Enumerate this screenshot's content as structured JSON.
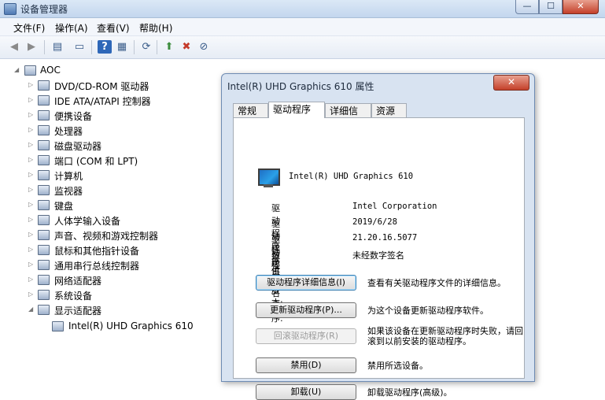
{
  "window": {
    "title": "设备管理器",
    "min": "—",
    "max": "☐",
    "close": "✕"
  },
  "menu": [
    "文件(F)",
    "操作(A)",
    "查看(V)",
    "帮助(H)"
  ],
  "tree": {
    "root": "AOC",
    "categories": [
      "DVD/CD-ROM 驱动器",
      "IDE ATA/ATAPI 控制器",
      "便携设备",
      "处理器",
      "磁盘驱动器",
      "端口 (COM 和 LPT)",
      "计算机",
      "监视器",
      "键盘",
      "人体学输入设备",
      "声音、视频和游戏控制器",
      "鼠标和其他指针设备",
      "通用串行总线控制器",
      "网络适配器",
      "系统设备",
      "显示适配器"
    ],
    "child": "Intel(R) UHD Graphics 610"
  },
  "dialog": {
    "title": "Intel(R) UHD Graphics 610 属性",
    "close": "✕",
    "tabs": [
      "常规",
      "驱动程序",
      "详细信息",
      "资源"
    ],
    "active_tab": "驱动程序",
    "device_name": "Intel(R) UHD Graphics 610",
    "info": [
      {
        "key": "驱动程序提供商:",
        "value": "Intel Corporation"
      },
      {
        "key": "驱动程序日期:",
        "value": "2019/6/28"
      },
      {
        "key": "驱动程序版本:",
        "value": "21.20.16.5077"
      },
      {
        "key": "数字签名程序:",
        "value": "未经数字签名"
      }
    ],
    "buttons": [
      {
        "label": "驱动程序详细信息(I)",
        "desc": "查看有关驱动程序文件的详细信息。",
        "state": "focused"
      },
      {
        "label": "更新驱动程序(P)...",
        "desc": "为这个设备更新驱动程序软件。",
        "state": "normal"
      },
      {
        "label": "回滚驱动程序(R)",
        "desc": "如果该设备在更新驱动程序时失败，请回滚到以前安装的驱动程序。",
        "state": "disabled"
      },
      {
        "label": "禁用(D)",
        "desc": "禁用所选设备。",
        "state": "normal"
      },
      {
        "label": "卸载(U)",
        "desc": "卸载驱动程序(高级)。",
        "state": "normal"
      }
    ]
  }
}
